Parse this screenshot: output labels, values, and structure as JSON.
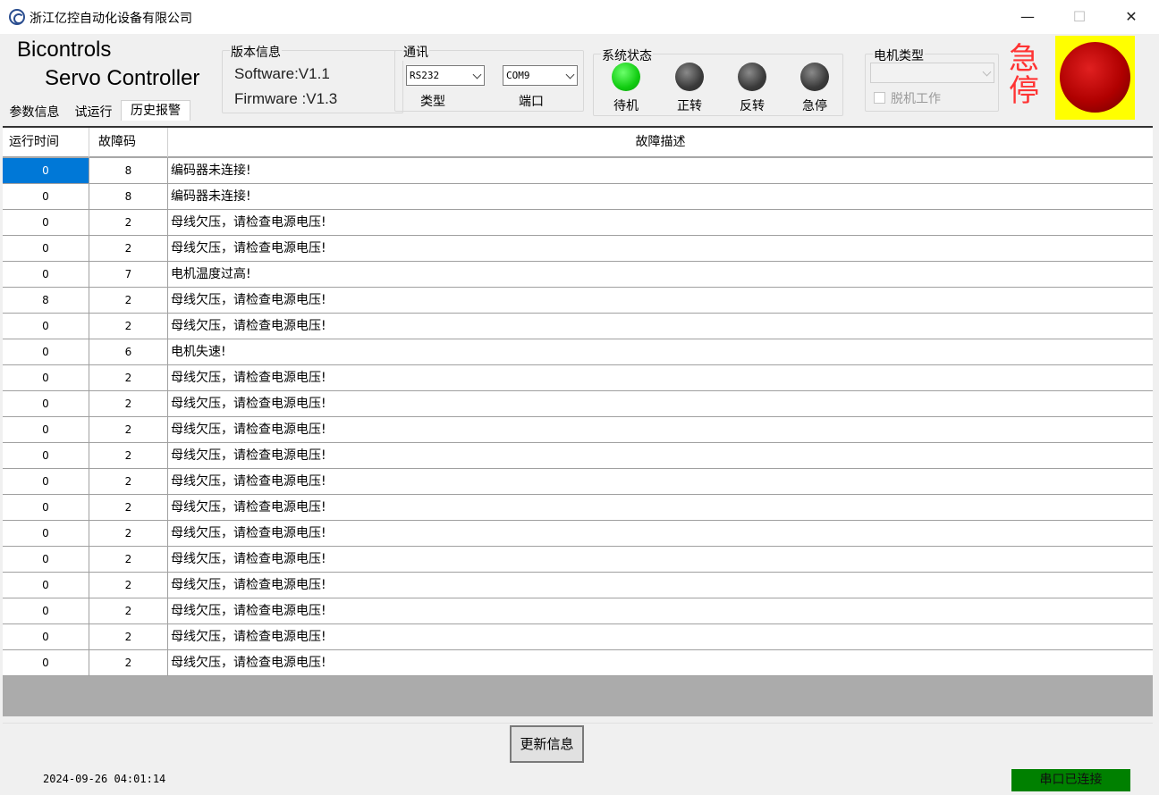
{
  "window": {
    "title": "浙江亿控自动化设备有限公司",
    "minimize": "—",
    "maximize": "☐",
    "close": "✕"
  },
  "brand": {
    "line1": "Bicontrols",
    "line2": "Servo Controller"
  },
  "version": {
    "legend": "版本信息",
    "software": "Software:V1.1",
    "firmware": "Firmware :V1.3"
  },
  "comm": {
    "legend": "通讯",
    "type_value": "RS232",
    "type_label": "类型",
    "port_value": "COM9",
    "port_label": "端口"
  },
  "system_status": {
    "legend": "系统状态",
    "indicators": [
      {
        "label": "待机",
        "state": "on"
      },
      {
        "label": "正转",
        "state": "off"
      },
      {
        "label": "反转",
        "state": "off"
      },
      {
        "label": "急停",
        "state": "off"
      }
    ]
  },
  "motor": {
    "legend": "电机类型",
    "type_value": "",
    "offline_label": "脱机工作",
    "offline_checked": false
  },
  "estop": {
    "label": "急停",
    "indicator_color": "#c00000",
    "background": "#ffff00"
  },
  "tabs": [
    {
      "label": "参数信息",
      "active": false
    },
    {
      "label": "试运行",
      "active": false
    },
    {
      "label": "历史报警",
      "active": true
    }
  ],
  "table": {
    "columns": [
      "运行时间",
      "故障码",
      "故障描述"
    ],
    "rows": [
      {
        "time": "0",
        "code": "8",
        "desc": "编码器未连接!"
      },
      {
        "time": "0",
        "code": "8",
        "desc": "编码器未连接!"
      },
      {
        "time": "0",
        "code": "2",
        "desc": "母线欠压，请检查电源电压!"
      },
      {
        "time": "0",
        "code": "2",
        "desc": "母线欠压，请检查电源电压!"
      },
      {
        "time": "0",
        "code": "7",
        "desc": "电机温度过高!"
      },
      {
        "time": "8",
        "code": "2",
        "desc": "母线欠压，请检查电源电压!"
      },
      {
        "time": "0",
        "code": "2",
        "desc": "母线欠压，请检查电源电压!"
      },
      {
        "time": "0",
        "code": "6",
        "desc": "电机失速!"
      },
      {
        "time": "0",
        "code": "2",
        "desc": "母线欠压，请检查电源电压!"
      },
      {
        "time": "0",
        "code": "2",
        "desc": "母线欠压，请检查电源电压!"
      },
      {
        "time": "0",
        "code": "2",
        "desc": "母线欠压，请检查电源电压!"
      },
      {
        "time": "0",
        "code": "2",
        "desc": "母线欠压，请检查电源电压!"
      },
      {
        "time": "0",
        "code": "2",
        "desc": "母线欠压，请检查电源电压!"
      },
      {
        "time": "0",
        "code": "2",
        "desc": "母线欠压，请检查电源电压!"
      },
      {
        "time": "0",
        "code": "2",
        "desc": "母线欠压，请检查电源电压!"
      },
      {
        "time": "0",
        "code": "2",
        "desc": "母线欠压，请检查电源电压!"
      },
      {
        "time": "0",
        "code": "2",
        "desc": "母线欠压，请检查电源电压!"
      },
      {
        "time": "0",
        "code": "2",
        "desc": "母线欠压，请检查电源电压!"
      },
      {
        "time": "0",
        "code": "2",
        "desc": "母线欠压，请检查电源电压!"
      },
      {
        "time": "0",
        "code": "2",
        "desc": "母线欠压，请检查电源电压!"
      }
    ],
    "selected_row": 0
  },
  "refresh_button": "更新信息",
  "status": {
    "datetime": "2024-09-26 04:01:14",
    "connection": "串口已连接",
    "connection_color": "#008000"
  }
}
